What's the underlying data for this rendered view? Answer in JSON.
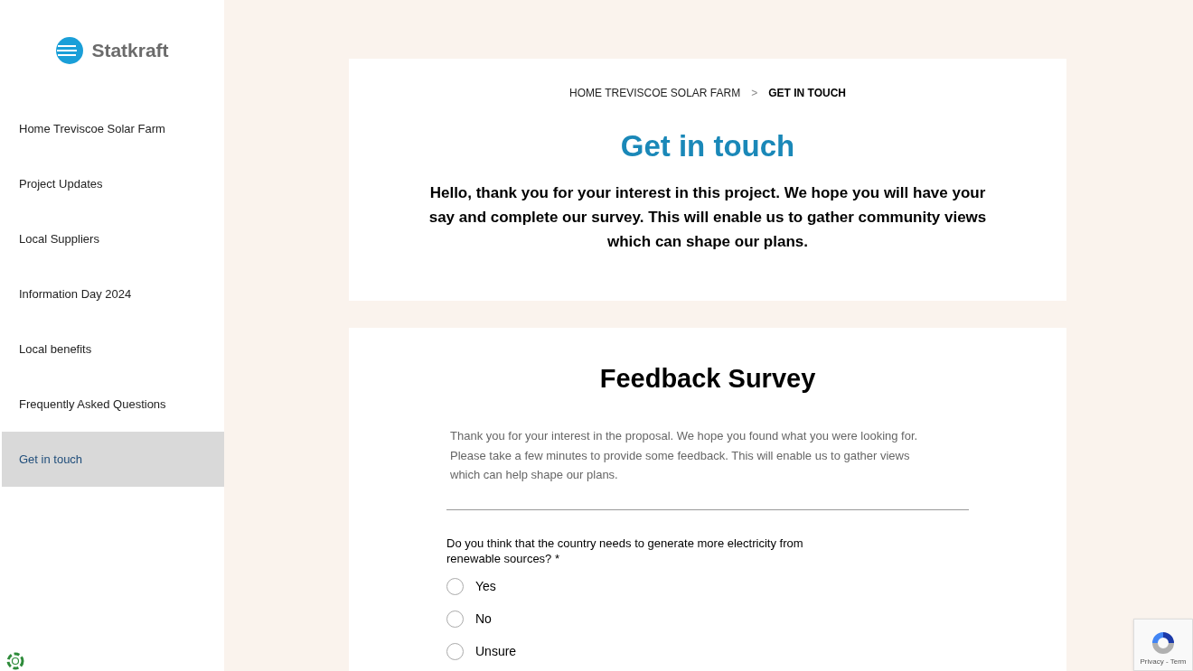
{
  "sidebar": {
    "logo": {
      "text": "Statkraft"
    },
    "items": [
      {
        "label": "Home Treviscoe Solar Farm",
        "selected": false
      },
      {
        "label": "Project Updates",
        "selected": false
      },
      {
        "label": "Local Suppliers",
        "selected": false
      },
      {
        "label": "Information Day 2024",
        "selected": false
      },
      {
        "label": "Local benefits",
        "selected": false
      },
      {
        "label": "Frequently Asked Questions",
        "selected": false
      },
      {
        "label": "Get in touch",
        "selected": true
      }
    ]
  },
  "header_card": {
    "breadcrumb": [
      {
        "label": "HOME TREVISCOE SOLAR FARM",
        "current": false
      },
      {
        "label": "GET IN TOUCH",
        "current": true
      }
    ],
    "separator": ">",
    "title": "Get in touch",
    "intro": "Hello, thank you for your interest in this project. We hope you will have your say and complete our survey. This will enable us to gather community views which can shape our plans."
  },
  "survey": {
    "title": "Feedback Survey",
    "description": "Thank you for your interest in the proposal. We hope you found what you were looking for. Please take a few minutes to provide some feedback. This will enable us to gather views which can help shape our plans.",
    "question": "Do you think that the country needs to generate more electricity from renewable sources? *",
    "options": [
      {
        "label": "Yes",
        "selected": false
      },
      {
        "label": "No",
        "selected": false
      },
      {
        "label": "Unsure",
        "selected": false
      }
    ]
  },
  "recaptcha": {
    "text": "Privacy - Term"
  }
}
